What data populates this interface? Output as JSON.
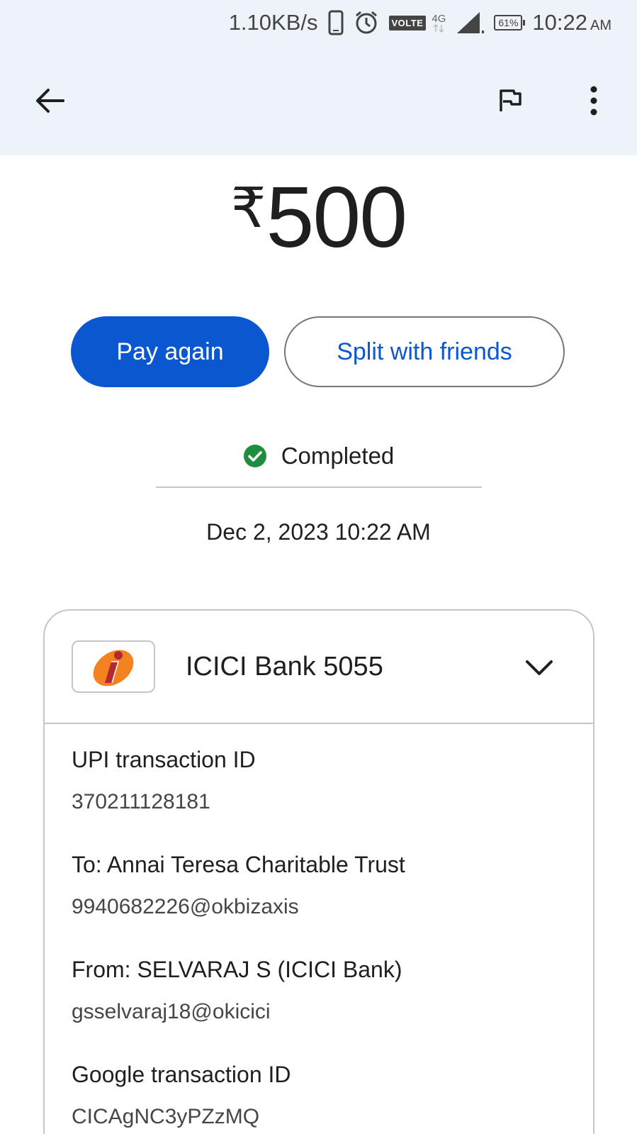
{
  "status_bar": {
    "speed": "1.10KB/s",
    "network_badge": "VOLTE",
    "network_type": "4G",
    "battery": "61%",
    "time": "10:22",
    "ampm": "AM",
    "icons": [
      "phone-icon",
      "alarm-icon",
      "signal-icon",
      "battery-icon"
    ]
  },
  "app_bar": {
    "icons": [
      "back-arrow-icon",
      "flag-icon",
      "more-vert-icon"
    ]
  },
  "payment": {
    "currency_symbol": "₹",
    "amount": "500",
    "status": "Completed",
    "datetime": "Dec 2, 2023 10:22 AM"
  },
  "actions": {
    "pay_again": "Pay again",
    "split": "Split with friends"
  },
  "card": {
    "bank_name": "ICICI Bank 5055",
    "details": [
      {
        "label": "UPI transaction ID",
        "value": "370211128181"
      },
      {
        "label": "To: Annai Teresa Charitable Trust",
        "value": "9940682226@okbizaxis"
      },
      {
        "label": "From: SELVARAJ S (ICICI Bank)",
        "value": "gsselvaraj18@okicici"
      },
      {
        "label": "Google transaction ID",
        "value": "CICAgNC3yPZzMQ"
      }
    ]
  },
  "colors": {
    "primary": "#0b57d0",
    "success": "#1e8e3e",
    "app_bar_bg": "#eef2f9",
    "icici_orange": "#f58220",
    "icici_red": "#b02a30"
  }
}
